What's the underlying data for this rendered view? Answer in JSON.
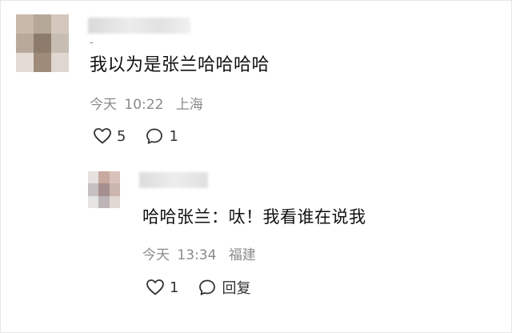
{
  "comment": {
    "username_hidden": "",
    "username_suffix": "-",
    "text": "我以为是张兰哈哈哈哈",
    "date": "今天",
    "time": "10:22",
    "location": "上海",
    "likes": "5",
    "replies": "1",
    "avatar_colors": [
      "#c9b9ab",
      "#b5a898",
      "#d4c8bd",
      "#b9a99b",
      "#8d7c6c",
      "#c7bdb3",
      "#e4dcd4",
      "#9e8b79",
      "#ded6cf"
    ]
  },
  "reply": {
    "username_hidden": "",
    "text": "哈哈张兰：呔！我看谁在说我",
    "date": "今天",
    "time": "13:34",
    "location": "福建",
    "likes": "1",
    "reply_label": "回复",
    "avatar_colors": [
      "#e7e2df",
      "#caa9a0",
      "#d9c2bb",
      "#c7c0c3",
      "#a68f8f",
      "#cbb6ae",
      "#e6e3e3",
      "#bdb4b5",
      "#e1d7d3"
    ]
  },
  "icons": {
    "like": "heart-outline-icon",
    "comment": "speech-bubble-icon"
  }
}
